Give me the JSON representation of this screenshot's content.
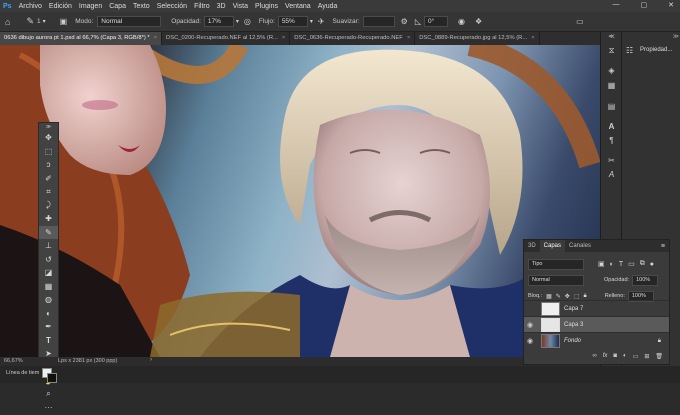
{
  "menu": {
    "app_icon": "Ps",
    "items": [
      "Archivo",
      "Edición",
      "Imagen",
      "Capa",
      "Texto",
      "Selección",
      "Filtro",
      "3D",
      "Vista",
      "Plugins",
      "Ventana",
      "Ayuda"
    ],
    "window_controls": [
      "minimize-icon",
      "maximize-icon",
      "close-icon"
    ]
  },
  "options": {
    "brush_size": "1",
    "mode_label": "Modo:",
    "mode_value": "Normal",
    "opacity_label": "Opacidad:",
    "opacity_value": "17%",
    "flow_label": "Flujo:",
    "flow_value": "55%",
    "smooth_label": "Suavizar:",
    "angle_value": "0°"
  },
  "tabs": [
    {
      "label": "0636 dibujo aurora pt 1.psd al 66,7% (Capa 3, RGB/8*) *",
      "active": true
    },
    {
      "label": "DSC_0200-Recuperado.NEF al 12,5% (R...",
      "active": false
    },
    {
      "label": "DSC_0636-Recuperado-Recuperado.NEF",
      "active": false
    },
    {
      "label": "DSC_0889-Recuperado.jpg al 12,5% (R...",
      "active": false
    }
  ],
  "status": {
    "zoom": "66,67%",
    "dimensions": "Lps x 2381 px (300 ppp)"
  },
  "bottom_label": "Línea de tiem",
  "tools": [
    "move-icon",
    "marquee-icon",
    "lasso-icon",
    "quick-select-icon",
    "crop-icon",
    "eyedropper-icon",
    "healing-icon",
    "brush-icon",
    "stamp-icon",
    "history-brush-icon",
    "eraser-icon",
    "gradient-icon",
    "blur-icon",
    "dodge-icon",
    "pen-icon",
    "type-icon",
    "path-select-icon",
    "shape-icon",
    "hand-icon",
    "zoom-icon"
  ],
  "properties_tab": "Propiedad...",
  "layers_panel": {
    "tabs": [
      "3D",
      "Capas",
      "Canales"
    ],
    "active_tab": "Capas",
    "filter_value": "Tipo",
    "blend_mode": "Normal",
    "opacity_label": "Opacidad:",
    "opacity_value": "100%",
    "lock_label": "Bloq.:",
    "fill_label": "Relleno:",
    "fill_value": "100%",
    "layers": [
      {
        "name": "Capa 7",
        "visible": false,
        "selected": false
      },
      {
        "name": "Capa 3",
        "visible": true,
        "selected": true
      },
      {
        "name": "Fondo",
        "visible": true,
        "selected": false
      }
    ]
  },
  "colors": {
    "ui_dark": "#2b2b2b",
    "panel": "#3b3b3b",
    "menubar": "#3a3a3a",
    "accent_selected": "#5a5a5a"
  }
}
